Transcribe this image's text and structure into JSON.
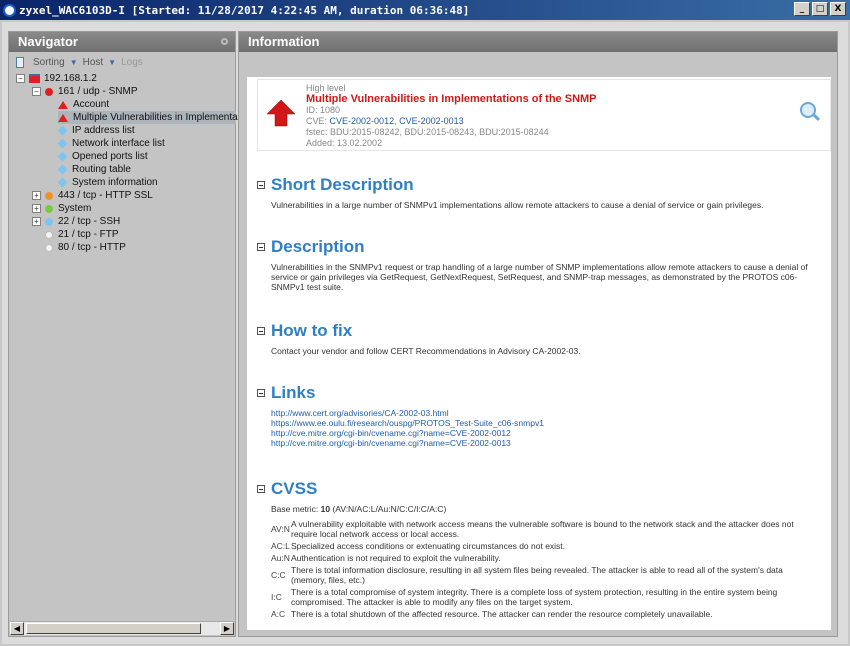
{
  "window": {
    "title": "zyxel_WAC6103D-I [Started: 11/28/2017 4:22:45 AM, duration 06:36:48]",
    "min_label": "_",
    "max_label": "□",
    "close_label": "X"
  },
  "navigator": {
    "title": "Navigator",
    "toolbar": {
      "sorting": "Sorting",
      "host": "Host",
      "logs": "Logs"
    },
    "tree": {
      "host": "192.168.1.2",
      "snmp": "161 / udp - SNMP",
      "account": "Account",
      "multiple": "Multiple Vulnerabilities in Implementations",
      "ip_list": "IP address list",
      "nic_list": "Network interface list",
      "ports": "Opened ports list",
      "routing": "Routing table",
      "sysinfo": "System information",
      "ssl": "443 / tcp - HTTP SSL",
      "system": "System",
      "ssh": "22 / tcp - SSH",
      "ftp": "21 / tcp - FTP",
      "http": "80 / tcp - HTTP"
    }
  },
  "info": {
    "title": "Information",
    "vuln": {
      "level": "High level",
      "name": "Multiple Vulnerabilities in Implementations of the SNMP",
      "id": "ID: 1080",
      "cve_prefix": "CVE:",
      "cve1": "CVE-2002-0012",
      "cve2": "CVE-2002-0013",
      "fstec": "fstec: BDU:2015-08242, BDU:2015-08243, BDU:2015-08244",
      "added": "Added: 13.02.2002"
    },
    "short_desc": {
      "title": "Short Description",
      "text": "Vulnerabilities in a large number of SNMPv1 implementations allow remote attackers to cause a denial of service or gain privileges."
    },
    "description": {
      "title": "Description",
      "text": "Vulnerabilities in the SNMPv1 request or trap handling of a large number of SNMP implementations allow remote attackers to cause a denial of service or gain privileges via GetRequest, GetNextRequest, SetRequest, and SNMP-trap messages, as demonstrated by the PROTOS c06-SNMPv1 test suite."
    },
    "howto": {
      "title": "How to fix",
      "text": "Contact your vendor and follow CERT Recommendations in Advisory CA-2002-03."
    },
    "links": {
      "title": "Links",
      "items": [
        "http://www.cert.org/advisories/CA-2002-03.html",
        "https://www.ee.oulu.fi/research/ouspg/PROTOS_Test-Suite_c06-snmpv1",
        "http://cve.mitre.org/cgi-bin/cvename.cgi?name=CVE-2002-0012",
        "http://cve.mitre.org/cgi-bin/cvename.cgi?name=CVE-2002-0013"
      ]
    },
    "cvss": {
      "title": "CVSS",
      "base_label": "Base metric:",
      "base_value": "10",
      "vector": "(AV:N/AC:L/Au:N/C:C/I:C/A:C)",
      "rows": [
        {
          "key": "AV:N",
          "text": "A vulnerability exploitable with network access means the vulnerable software is bound to the network stack and the attacker does not require local network access or local access."
        },
        {
          "key": "AC:L",
          "text": "Specialized access conditions or extenuating circumstances do not exist."
        },
        {
          "key": "Au:N",
          "text": "Authentication is not required to exploit the vulnerability."
        },
        {
          "key": "C:C",
          "text": "There is total information disclosure, resulting in all system files being revealed. The attacker is able to read all of the system's data (memory, files, etc.)"
        },
        {
          "key": "I:C",
          "text": "There is a total compromise of system integrity. There is a complete loss of system protection, resulting in the entire system being compromised. The attacker is able to modify any files on the target system."
        },
        {
          "key": "A:C",
          "text": "There is a total shutdown of the affected resource. The attacker can render the resource completely unavailable."
        }
      ]
    }
  },
  "colors": {
    "accent": "#2f7fc3",
    "severity_high": "#d01818",
    "link": "#1f5ea8"
  }
}
